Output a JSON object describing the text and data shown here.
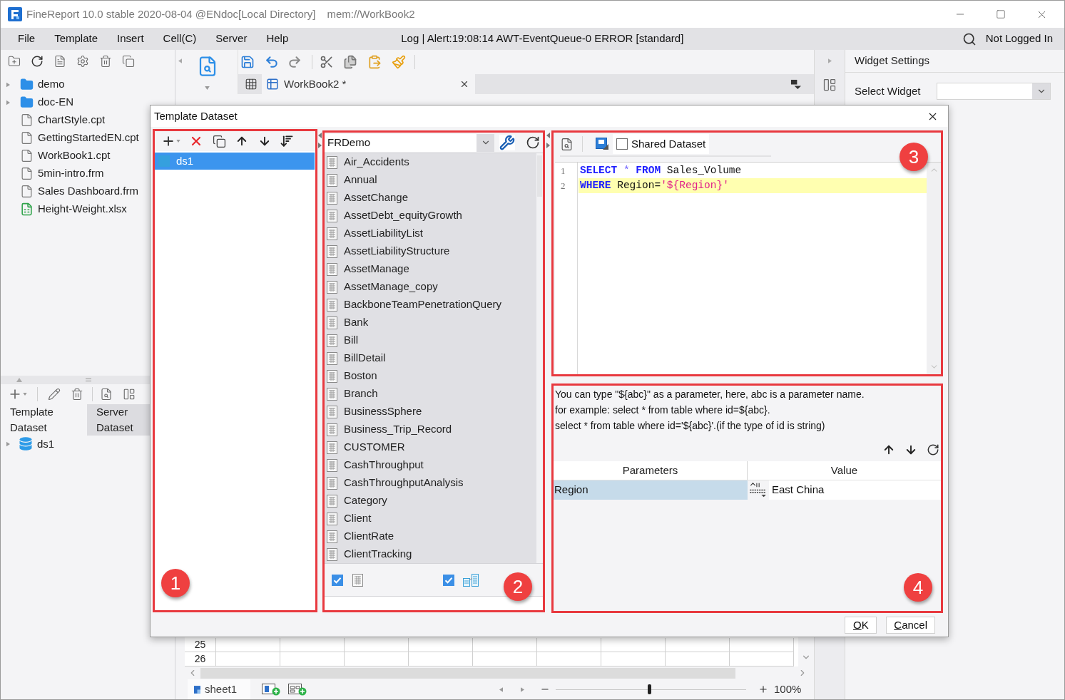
{
  "window": {
    "title": "FineReport 10.0 stable 2020-08-04 @ENdoc[Local Directory]",
    "path": "mem://WorkBook2"
  },
  "menu": [
    "File",
    "Template",
    "Insert",
    "Cell(C)",
    "Server",
    "Help"
  ],
  "log_message": "Log | Alert:19:08:14 AWT-EventQueue-0 ERROR [standard]",
  "login_status": "Not Logged In",
  "file_tree": [
    {
      "name": "demo",
      "kind": "folder"
    },
    {
      "name": "doc-EN",
      "kind": "folder"
    },
    {
      "name": "ChartStyle.cpt",
      "kind": "file"
    },
    {
      "name": "GettingStartedEN.cpt",
      "kind": "file"
    },
    {
      "name": "WorkBook1.cpt",
      "kind": "file"
    },
    {
      "name": "5min-intro.frm",
      "kind": "file"
    },
    {
      "name": "Sales Dashboard.frm",
      "kind": "file"
    },
    {
      "name": "Height-Weight.xlsx",
      "kind": "spreadsheet"
    }
  ],
  "dataset_tabs": [
    {
      "label": "Template Dataset",
      "selected": true
    },
    {
      "label": "Server Dataset",
      "selected": false
    }
  ],
  "dataset_tree": [
    {
      "name": "ds1"
    }
  ],
  "workbook_tab": "WorkBook2 *",
  "widget_panel": {
    "title": "Widget Settings",
    "select_label": "Select Widget"
  },
  "sheet": {
    "row_numbers": [
      "25",
      "26"
    ],
    "tab": "sheet1",
    "zoom": {
      "level": 0.49,
      "reading": "100%"
    }
  },
  "dialog": {
    "title": "Template Dataset",
    "datasets": [
      {
        "name": "ds1",
        "selected": true
      }
    ],
    "connection": "FRDemo",
    "tables": [
      "Air_Accidents",
      "Annual",
      "AssetChange",
      "AssetDebt_equityGrowth",
      "AssetLiabilityList",
      "AssetLiabilityStructure",
      "AssetManage",
      "AssetManage_copy",
      "BackboneTeamPenetrationQuery",
      "Bank",
      "Bill",
      "BillDetail",
      "Boston",
      "Branch",
      "BusinessSphere",
      "Business_Trip_Record",
      "CUSTOMER",
      "CashThroughput",
      "CashThroughputAnalysis",
      "Category",
      "Client",
      "ClientRate",
      "ClientTracking"
    ],
    "filters": [
      {
        "kind": "table",
        "checked": true
      },
      {
        "kind": "view",
        "checked": true
      }
    ],
    "shared_dataset": {
      "label": "Shared Dataset",
      "checked": false
    },
    "sql_lines": [
      {
        "number": "1",
        "highlighted": false,
        "tokens": [
          {
            "kind": "keyword",
            "text": "SELECT"
          },
          {
            "kind": "operator",
            "text": " *"
          },
          {
            "kind": "keyword",
            "text": " FROM"
          },
          {
            "kind": "plain",
            "text": " Sales_Volume"
          }
        ]
      },
      {
        "number": "2",
        "highlighted": true,
        "tokens": [
          {
            "kind": "keyword",
            "text": "WHERE"
          },
          {
            "kind": "plain",
            "text": " Region="
          },
          {
            "kind": "string",
            "text": "'${Region}'"
          }
        ]
      }
    ],
    "help_text": [
      "You can type \"${abc}\" as a parameter, here, abc is a parameter name.",
      "for example: select * from table where id=${abc}.",
      "select * from table where id='${abc}'.(if the type of id is string)"
    ],
    "parameters": {
      "columns": [
        "Parameters",
        "Value"
      ],
      "rows": [
        {
          "name": "Region",
          "value": "East China",
          "selected": true
        }
      ]
    },
    "buttons": [
      "OK",
      "Cancel"
    ],
    "annotations": [
      "1",
      "2",
      "3",
      "4"
    ]
  }
}
